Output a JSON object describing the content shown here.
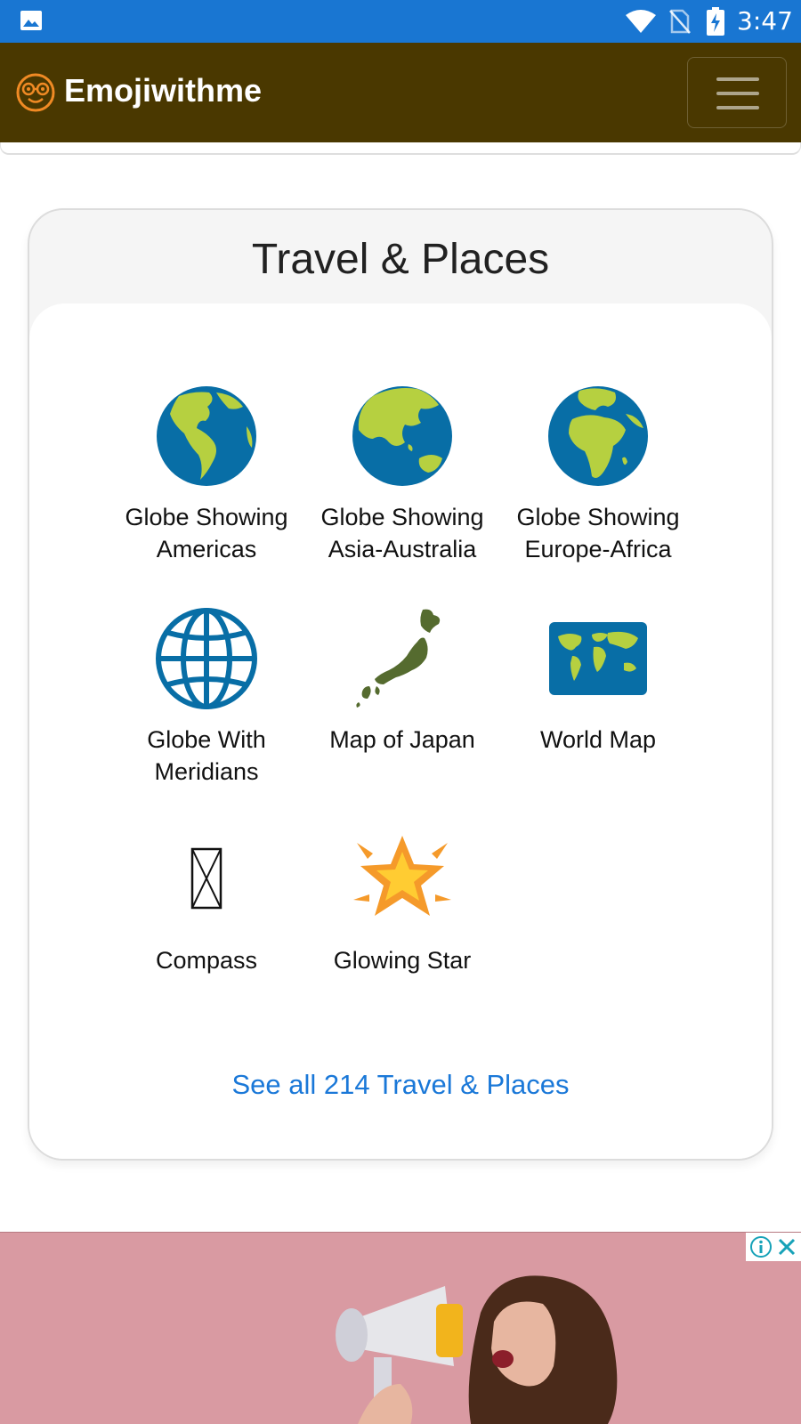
{
  "status_bar": {
    "time": "3:47",
    "icons": [
      "image-icon",
      "wifi-icon",
      "no-sim-icon",
      "battery-charging-icon"
    ],
    "background": "#1976d2"
  },
  "navbar": {
    "brand": "Emojiwithme",
    "logo_icon": "nerd-face-icon",
    "menu_icon": "hamburger-menu-icon",
    "background": "#4a3800"
  },
  "section": {
    "title": "Travel & Places",
    "items": [
      {
        "icon": "globe-americas-icon",
        "name": "Globe Showing Americas"
      },
      {
        "icon": "globe-asia-australia-icon",
        "name": "Globe Showing Asia-Australia"
      },
      {
        "icon": "globe-europe-africa-icon",
        "name": "Globe Showing Europe-Africa"
      },
      {
        "icon": "globe-with-meridians-icon",
        "name": "Globe With Meridians"
      },
      {
        "icon": "map-of-japan-icon",
        "name": "Map of Japan"
      },
      {
        "icon": "world-map-icon",
        "name": "World Map"
      },
      {
        "icon": "missing-glyph-icon",
        "name": "Compass"
      },
      {
        "icon": "glowing-star-icon",
        "name": "Glowing Star"
      }
    ],
    "see_all": "See all 214 Travel & Places",
    "link_color": "#1a78d8"
  },
  "ad": {
    "icons": [
      "ad-info-icon",
      "ad-close-icon"
    ],
    "background": "#d99aa2"
  }
}
